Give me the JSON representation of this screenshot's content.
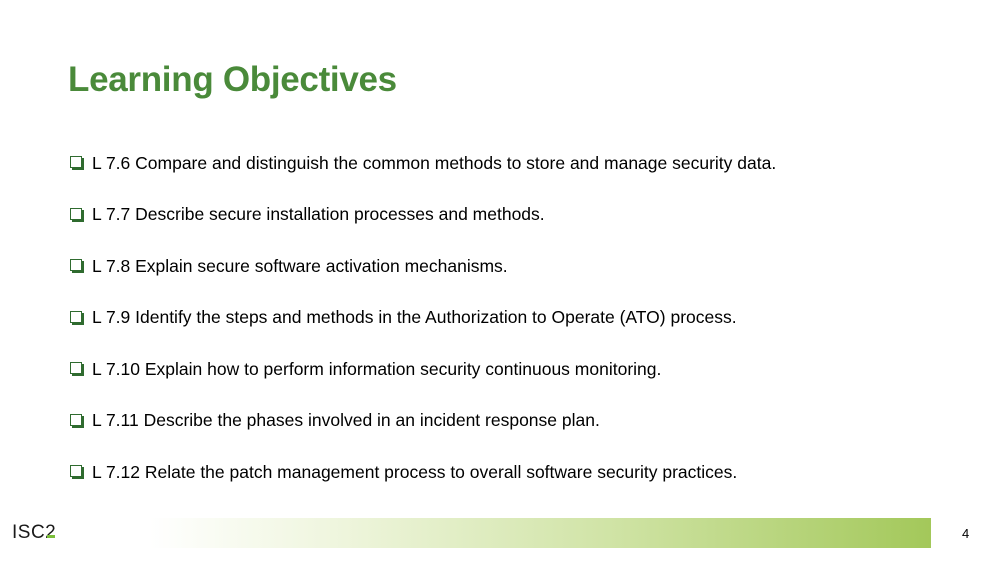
{
  "slide": {
    "title": "Learning Objectives",
    "objectives": [
      "L 7.6 Compare and distinguish the common methods to store and manage security data.",
      "L 7.7 Describe secure installation processes and methods.",
      "L 7.8 Explain secure software activation mechanisms.",
      "L 7.9 Identify the steps and methods in the Authorization to Operate (ATO) process.",
      "L 7.10 Explain how to perform information security continuous monitoring.",
      "L 7.11 Describe the phases involved in an incident response plan.",
      "L 7.12 Relate the patch management process to overall software security practices."
    ],
    "bullet_icon": "checkbox-icon"
  },
  "footer": {
    "logo_text": "ISC2",
    "page_number": "4"
  },
  "colors": {
    "title": "#4a8a3a",
    "bullet": "#2f6b2f",
    "footer_bar_end": "#a3c85a",
    "logo_accent": "#7bbf3a"
  }
}
